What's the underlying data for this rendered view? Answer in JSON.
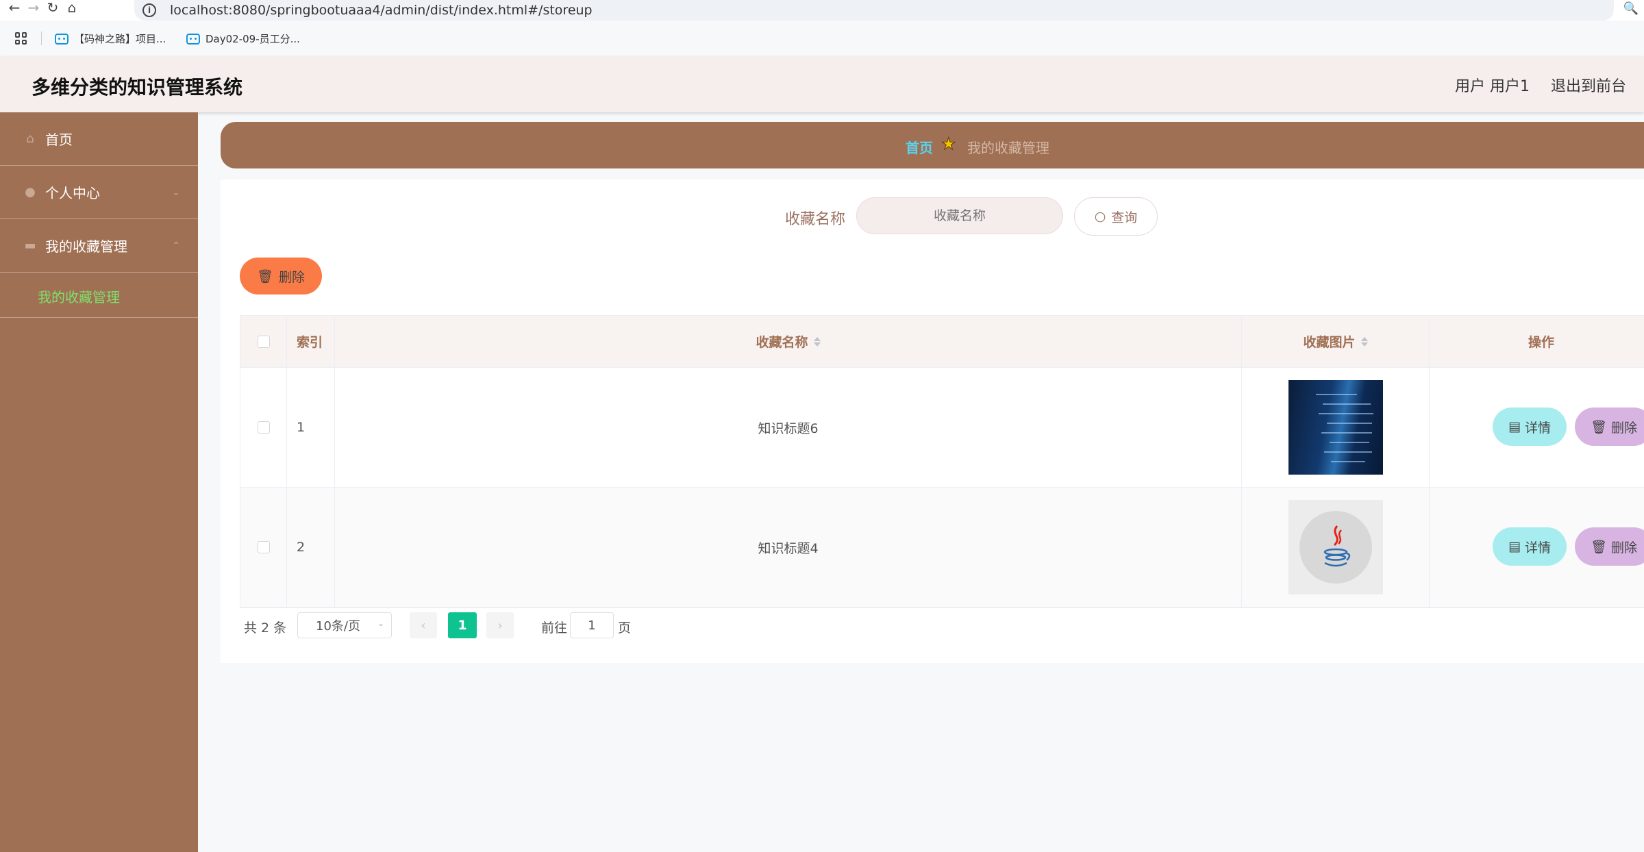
{
  "browser": {
    "url": "localhost:8080/springbootuaaa4/admin/dist/index.html#/storeup",
    "bookmarks": [
      "【码神之路】项目...",
      "Day02-09-员工分..."
    ]
  },
  "header": {
    "title": "多维分类的知识管理系统",
    "user": "用户 用户1",
    "exit": "退出到前台"
  },
  "sidebar": {
    "items": [
      {
        "label": "首页",
        "icon": "home-icon"
      },
      {
        "label": "个人中心",
        "icon": "user-icon"
      },
      {
        "label": "我的收藏管理",
        "icon": "monitor-icon"
      }
    ],
    "sub_item": "我的收藏管理"
  },
  "breadcrumb": {
    "home": "首页",
    "current": "我的收藏管理"
  },
  "search": {
    "label": "收藏名称",
    "placeholder": "收藏名称",
    "button": "查询"
  },
  "toolbar": {
    "delete": "删除"
  },
  "table": {
    "headers": {
      "index": "索引",
      "name": "收藏名称",
      "image": "收藏图片",
      "ops": "操作"
    },
    "rows": [
      {
        "index": "1",
        "name": "知识标题6",
        "image": "code-screen-image",
        "detail": "详情",
        "delete": "删除"
      },
      {
        "index": "2",
        "name": "知识标题4",
        "image": "java-logo-image",
        "detail": "详情",
        "delete": "删除"
      }
    ]
  },
  "pagination": {
    "total": "共 2 条",
    "page_size": "10条/页",
    "current": "1",
    "goto_label": "前往",
    "goto_value": "1",
    "page_unit": "页"
  },
  "colors": {
    "sidebar": "#a07054",
    "accent_green": "#0fc391",
    "delete_orange": "#fb7b47",
    "detail_cyan": "#a7ecef",
    "row_delete_purple": "#d8b4e2"
  }
}
